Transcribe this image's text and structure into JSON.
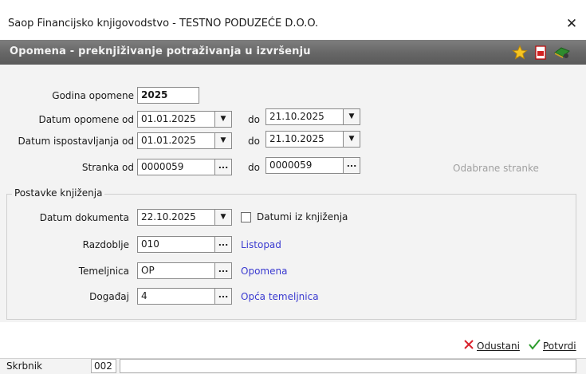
{
  "window": {
    "title": "Saop Financijsko knjigovodstvo - TESTNO PODUZEĆE D.O.O.",
    "close_symbol": "✕"
  },
  "header": {
    "title": "Opomena - preknjiživanje potraživanja u izvršenju",
    "icons": [
      "star-icon",
      "pdf-icon",
      "book-icon"
    ]
  },
  "form": {
    "godina": {
      "label": "Godina opomene",
      "value": "2025"
    },
    "datum_opomene": {
      "label": "Datum opomene od",
      "from": "01.01.2025",
      "to_label": "do",
      "to": "21.10.2025"
    },
    "datum_ispostavljanja": {
      "label": "Datum ispostavljanja od",
      "from": "01.01.2025",
      "to_label": "do",
      "to": "21.10.2025"
    },
    "stranka": {
      "label": "Stranka od",
      "from": "0000059",
      "to_label": "do",
      "to": "0000059"
    },
    "odabrane_stranke": "Odabrane stranke"
  },
  "postavke": {
    "group_label": "Postavke knjiženja",
    "datum_dokumenta": {
      "label": "Datum dokumenta",
      "value": "22.10.2025"
    },
    "datumi_iz_knjizenja": {
      "label": "Datumi iz knjiženja",
      "checked": false
    },
    "razdoblje": {
      "label": "Razdoblje",
      "value": "010",
      "desc": "Listopad"
    },
    "temeljnica": {
      "label": "Temeljnica",
      "value": "OP",
      "desc": "Opomena"
    },
    "dogadaj": {
      "label": "Događaj",
      "value": "4",
      "desc": "Opća temeljnica"
    }
  },
  "actions": {
    "cancel_label": "Odustani",
    "confirm_label": "Potvrdi",
    "cancel_color": "#d9232d",
    "confirm_color": "#2e9c2e"
  },
  "status": {
    "label": "Skrbnik",
    "value": "002"
  },
  "colors": {
    "link": "#3a3ad0",
    "header_bg": "#6b6b6b"
  },
  "symbols": {
    "dropdown": "▼",
    "dots": "..."
  }
}
